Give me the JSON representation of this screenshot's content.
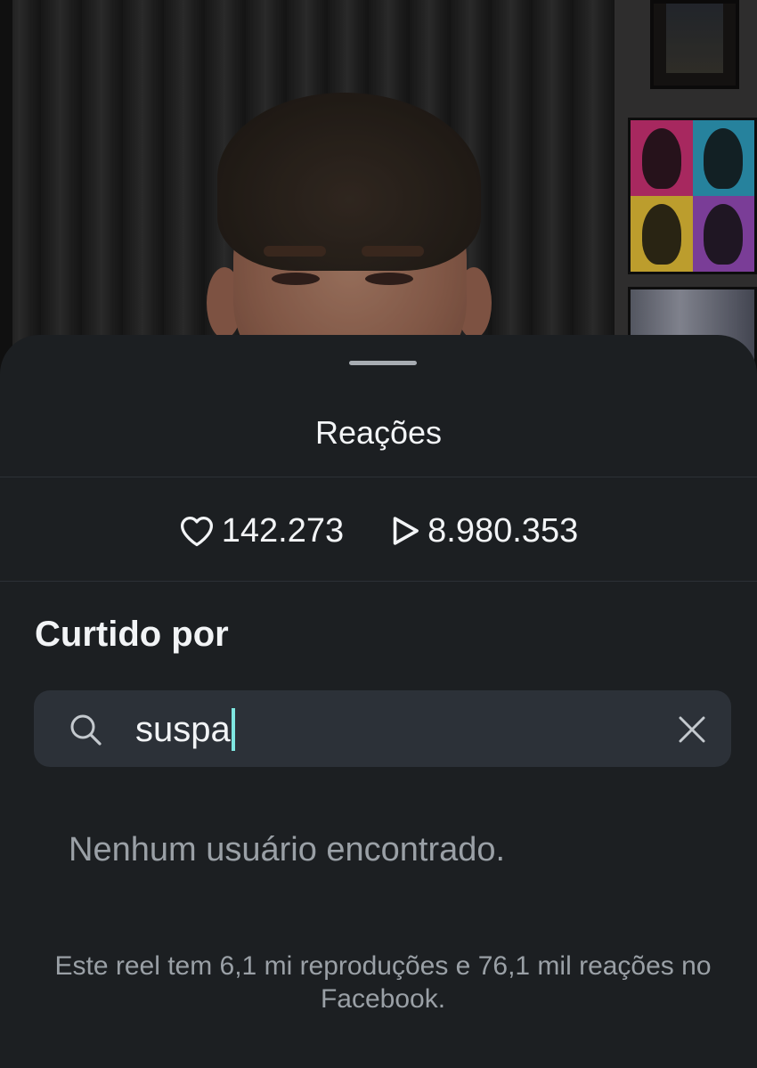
{
  "sheet": {
    "title": "Reações"
  },
  "stats": {
    "likes": "142.273",
    "likes_icon": "heart-icon",
    "plays": "8.980.353",
    "plays_icon": "play-icon"
  },
  "liked_by": {
    "title": "Curtido por"
  },
  "search": {
    "value": "suspa",
    "search_icon": "search-icon",
    "clear_icon": "close-icon"
  },
  "results": {
    "empty_message": "Nenhum usuário encontrado."
  },
  "footer": {
    "note": "Este reel tem 6,1 mi reproduções e 76,1 mil reações no Facebook."
  },
  "colors": {
    "sheet_bg": "#1c1f22",
    "search_bg": "#2c3138",
    "caret": "#7fe6e0",
    "text_primary": "#f2f4f6",
    "text_secondary": "#9aa0a6"
  }
}
